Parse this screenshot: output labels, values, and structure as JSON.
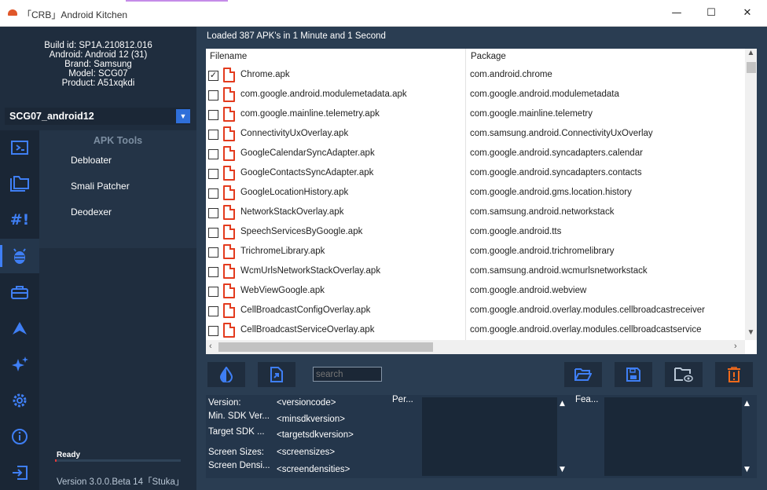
{
  "window": {
    "title": "「CRB」Android Kitchen",
    "minimize": "—",
    "maximize": "☐",
    "close": "✕"
  },
  "device_info": {
    "build_id": "Build id: SP1A.210812.016",
    "android": "Android: Android 12 (31)",
    "brand": "Brand: Samsung",
    "model": "Model: SCG07",
    "product": "Product: A51xqkdi"
  },
  "profile": {
    "name": "SCG07_android12",
    "dropdown_glyph": "▼"
  },
  "rail_icons": [
    "project-icon",
    "folders-icon",
    "hash-icon",
    "bug-android-icon",
    "toolbox-icon",
    "build-icon",
    "sparkle-icon",
    "settings-icon",
    "info-icon",
    "exit-icon"
  ],
  "apk_tools": {
    "header": "APK Tools",
    "items": [
      "Debloater",
      "Smali Patcher",
      "Deodexer"
    ]
  },
  "status": {
    "ready": "Ready",
    "version": "Version 3.0.0.Beta 14「Stuka」",
    "progress": 0.01
  },
  "main": {
    "loaded_text": "Loaded 387 APK's in 1 Minute and 1 Second",
    "columns": {
      "filename": "Filename",
      "package": "Package"
    },
    "rows": [
      {
        "file": "Chrome.apk",
        "package": "com.android.chrome",
        "checked": true
      },
      {
        "file": "com.google.android.modulemetadata.apk",
        "package": "com.google.android.modulemetadata",
        "checked": false
      },
      {
        "file": "com.google.mainline.telemetry.apk",
        "package": "com.google.mainline.telemetry",
        "checked": false
      },
      {
        "file": "ConnectivityUxOverlay.apk",
        "package": "com.samsung.android.ConnectivityUxOverlay",
        "checked": false
      },
      {
        "file": "GoogleCalendarSyncAdapter.apk",
        "package": "com.google.android.syncadapters.calendar",
        "checked": false
      },
      {
        "file": "GoogleContactsSyncAdapter.apk",
        "package": "com.google.android.syncadapters.contacts",
        "checked": false
      },
      {
        "file": "GoogleLocationHistory.apk",
        "package": "com.google.android.gms.location.history",
        "checked": false
      },
      {
        "file": "NetworkStackOverlay.apk",
        "package": "com.samsung.android.networkstack",
        "checked": false
      },
      {
        "file": "SpeechServicesByGoogle.apk",
        "package": "com.google.android.tts",
        "checked": false
      },
      {
        "file": "TrichromeLibrary.apk",
        "package": "com.google.android.trichromelibrary",
        "checked": false
      },
      {
        "file": "WcmUrlsNetworkStackOverlay.apk",
        "package": "com.samsung.android.wcmurlsnetworkstack",
        "checked": false
      },
      {
        "file": "WebViewGoogle.apk",
        "package": "com.google.android.webview",
        "checked": false
      },
      {
        "file": "CellBroadcastConfigOverlay.apk",
        "package": "com.google.android.overlay.modules.cellbroadcastreceiver",
        "checked": false
      },
      {
        "file": "CellBroadcastServiceOverlay.apk",
        "package": "com.google.android.overlay.modules.cellbroadcastservice",
        "checked": false
      }
    ],
    "search_placeholder": "search"
  },
  "details": {
    "labels": {
      "version": "Version:",
      "min_sdk": "Min. SDK Ver...",
      "target_sdk": "Target SDK ...",
      "screen_sizes": "Screen Sizes:",
      "screen_densities": "Screen Densi...",
      "permissions": "Per...",
      "features": "Fea..."
    },
    "values": {
      "version": "<versioncode>",
      "min_sdk": "<minsdkversion>",
      "target_sdk": "<targetsdkversion>",
      "screen_sizes": "<screensizes>",
      "screen_densities": "<screendensities>"
    }
  },
  "colors": {
    "accent": "#3f7ff5",
    "file_icon": "#e33b1e",
    "orange_button": "#f26a1b",
    "sidebar_bg": "#1f2d3e",
    "main_bg": "#2a3d52"
  }
}
